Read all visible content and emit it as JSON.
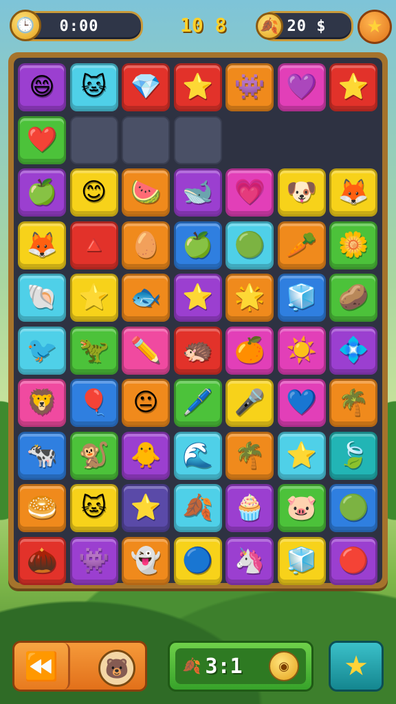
{
  "hud": {
    "timer": "0:00",
    "score": "10 8",
    "coins": "20 $",
    "clock_icon": "clock-icon",
    "leaf_icon": "leaf-icon",
    "star_icon": "star-icon"
  },
  "colors": {
    "purple": "#9b3fd0",
    "cyan": "#4fd0e8",
    "red": "#e2322a",
    "orange": "#f08a1c",
    "magenta": "#e23fb8",
    "green": "#4cc23a",
    "yellow": "#f7d21a",
    "blue": "#2f7fe0",
    "teal": "#22b5b5",
    "violet": "#5a4aa8",
    "pink": "#f04aa0"
  },
  "board": {
    "rows": [
      [
        [
          "purple",
          "😄"
        ],
        [
          "cyan",
          "🐱"
        ],
        [
          "red",
          "💎"
        ],
        [
          "red",
          "⭐"
        ],
        [
          "orange",
          "👾"
        ],
        [
          "magenta",
          "💜"
        ],
        [
          "red",
          "⭐"
        ]
      ],
      [
        [
          "green",
          "❤️"
        ],
        [
          "empty",
          ""
        ],
        [
          "empty",
          ""
        ],
        [
          "empty",
          ""
        ],
        [
          "blank",
          ""
        ],
        [
          "blank",
          ""
        ],
        [
          "blank",
          ""
        ]
      ],
      [
        [
          "purple",
          "🍏"
        ],
        [
          "yellow",
          "😊"
        ],
        [
          "orange",
          "🍉"
        ],
        [
          "purple",
          "🐋"
        ],
        [
          "magenta",
          "💗"
        ],
        [
          "yellow",
          "🐶"
        ],
        [
          "yellow",
          "🦊"
        ]
      ],
      [
        [
          "yellow",
          "🦊"
        ],
        [
          "red",
          "🔺"
        ],
        [
          "orange",
          "🥚"
        ],
        [
          "blue",
          "🍏"
        ],
        [
          "cyan",
          "🟢"
        ],
        [
          "orange",
          "🥕"
        ],
        [
          "green",
          "🌼"
        ]
      ],
      [
        [
          "cyan",
          "🐚"
        ],
        [
          "yellow",
          "⭐"
        ],
        [
          "orange",
          "🐟"
        ],
        [
          "purple",
          "⭐"
        ],
        [
          "orange",
          "🌟"
        ],
        [
          "blue",
          "🧊"
        ],
        [
          "green",
          "🥔"
        ]
      ],
      [
        [
          "cyan",
          "🐦"
        ],
        [
          "green",
          "🦖"
        ],
        [
          "pink",
          "✏️"
        ],
        [
          "red",
          "🦔"
        ],
        [
          "magenta",
          "🍊"
        ],
        [
          "magenta",
          "☀️"
        ],
        [
          "purple",
          "💠"
        ]
      ],
      [
        [
          "pink",
          "🦁"
        ],
        [
          "blue",
          "🎈"
        ],
        [
          "orange",
          "😐"
        ],
        [
          "green",
          "🖊️"
        ],
        [
          "yellow",
          "🎤"
        ],
        [
          "magenta",
          "💙"
        ],
        [
          "orange",
          "🌴"
        ]
      ],
      [
        [
          "blue",
          "🐄"
        ],
        [
          "green",
          "🐒"
        ],
        [
          "purple",
          "🐥"
        ],
        [
          "cyan",
          "🌊"
        ],
        [
          "orange",
          "🌴"
        ],
        [
          "cyan",
          "⭐"
        ],
        [
          "teal",
          "🍃"
        ]
      ],
      [
        [
          "orange",
          "🥯"
        ],
        [
          "yellow",
          "🐱"
        ],
        [
          "violet",
          "⭐"
        ],
        [
          "cyan",
          "🍂"
        ],
        [
          "purple",
          "🧁"
        ],
        [
          "green",
          "🐷"
        ],
        [
          "blue",
          "🟢"
        ]
      ],
      [
        [
          "red",
          "🌰"
        ],
        [
          "purple",
          "👾"
        ],
        [
          "orange",
          "👻"
        ],
        [
          "yellow",
          "🔵"
        ],
        [
          "purple",
          "🦄"
        ],
        [
          "yellow",
          "🧊"
        ],
        [
          "purple",
          "🔴"
        ]
      ]
    ]
  },
  "bottom": {
    "back_icon": "double-arrow-left-icon",
    "bear_icon": "bear-icon",
    "combo": "3:1",
    "combo_left_icon": "leaf-icon",
    "combo_right_icon": "coin-icon",
    "power_icon": "star-icon"
  }
}
